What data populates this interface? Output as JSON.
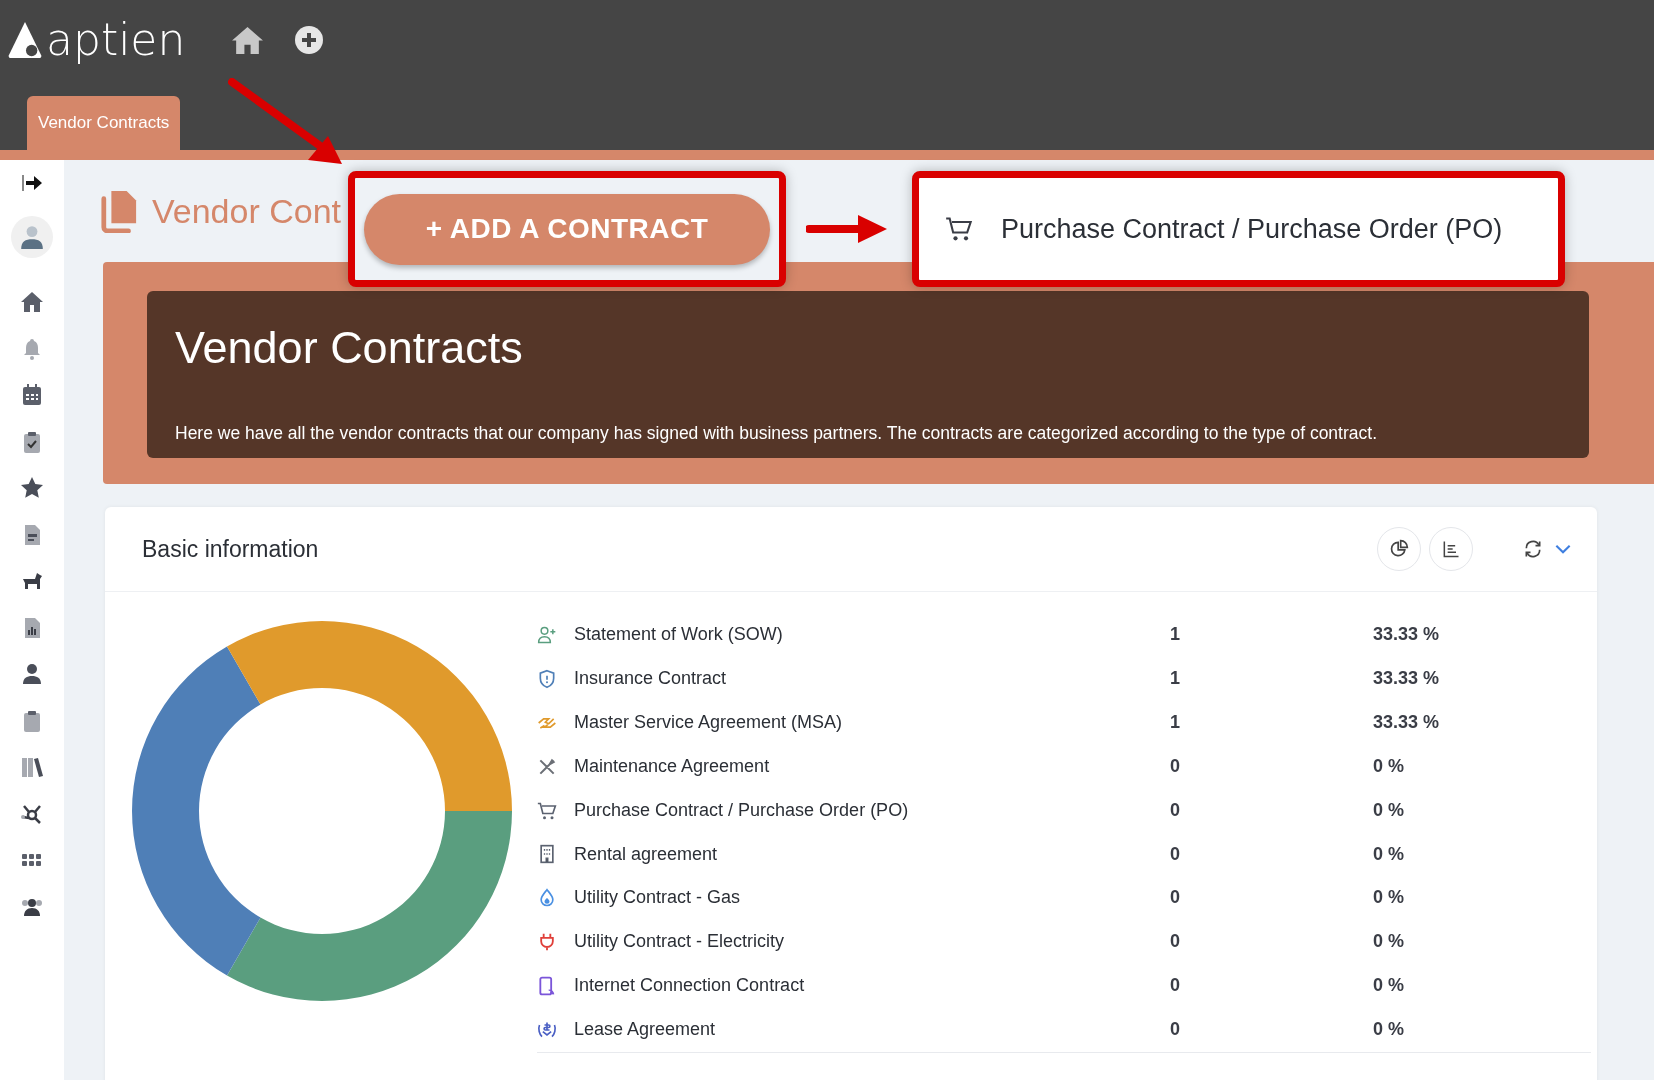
{
  "app": {
    "logo": "aptien"
  },
  "tabs": [
    {
      "label": "Vendor Contracts",
      "selected": true
    }
  ],
  "page": {
    "title": "Vendor Cont"
  },
  "annotation": {
    "add_button": "+ ADD A CONTRACT",
    "menu_option": "Purchase Contract / Purchase Order (PO)"
  },
  "hero": {
    "title": "Vendor Contracts",
    "description": "Here we have all the vendor contracts that our company has signed with business partners. The contracts are categorized according to the type of contract."
  },
  "card": {
    "title": "Basic information",
    "chart_data": {
      "type": "donut",
      "categories": [
        "Statement of Work (SOW)",
        "Insurance Contract",
        "Master Service Agreement (MSA)"
      ],
      "values": [
        33.33,
        33.33,
        33.33
      ]
    },
    "rows": [
      {
        "count": "1",
        "percent": "33.33 %",
        "color": "#5a9e7f"
      },
      {
        "count": "1",
        "percent": "33.33 %",
        "color": "#4f7fb7"
      },
      {
        "count": "1",
        "percent": "33.33 %",
        "color": "#e09a2c"
      },
      {
        "name": "Maintenance Agreement",
        "count": "0",
        "percent": "0 %",
        "color": "#6b6f76"
      },
      {
        "name": "Purchase Contract / Purchase Order (PO)",
        "count": "0",
        "percent": "0 %",
        "color": "#5b6270"
      },
      {
        "name": "Rental agreement",
        "count": "0",
        "percent": "0 %",
        "color": "#5b6270"
      },
      {
        "name": "Utility Contract - Gas",
        "count": "0",
        "percent": "0 %",
        "color": "#4a90e2"
      },
      {
        "name": "Utility Contract - Electricity",
        "count": "0",
        "percent": "0 %",
        "color": "#e0403a"
      },
      {
        "name": "Internet Connection Contract",
        "count": "0",
        "percent": "0 %",
        "color": "#7b55d9"
      },
      {
        "name": "Lease Agreement",
        "count": "0",
        "percent": "0 %",
        "color": "#4a5fc4"
      }
    ]
  }
}
